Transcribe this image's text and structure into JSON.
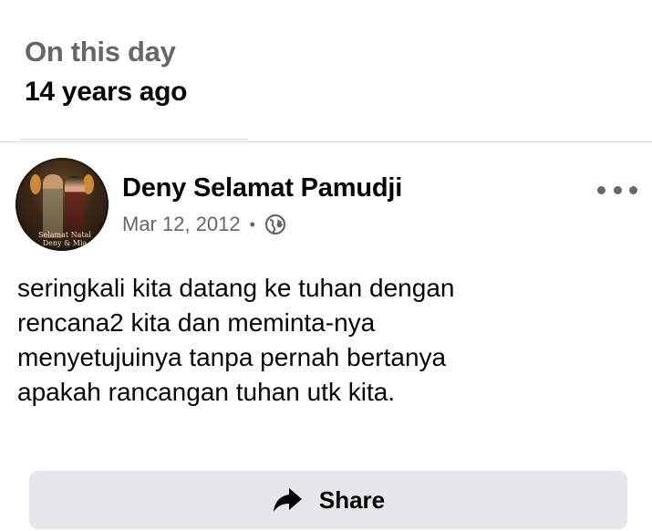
{
  "memory": {
    "label": "On this day",
    "years_ago": "14 years ago"
  },
  "post": {
    "author": {
      "name": "Deny Selamat Pamudji",
      "avatar_caption": "Selamat Natal Deny & Mia"
    },
    "date": "Mar 12, 2012",
    "separator": "•",
    "audience_icon": "globe-icon",
    "more_icon": "more-horizontal-icon",
    "text": "seringkali kita datang ke tuhan dengan\nrencana2 kita dan meminta-nya\nmenyetujuinya tanpa pernah bertanya\napakah rancangan tuhan utk kita."
  },
  "actions": {
    "share_label": "Share",
    "share_icon": "share-arrow-icon"
  },
  "colors": {
    "secondary_text": "#65676b",
    "primary_text": "#050505",
    "button_bg": "#e4e6eb",
    "divider": "#dadde1"
  }
}
